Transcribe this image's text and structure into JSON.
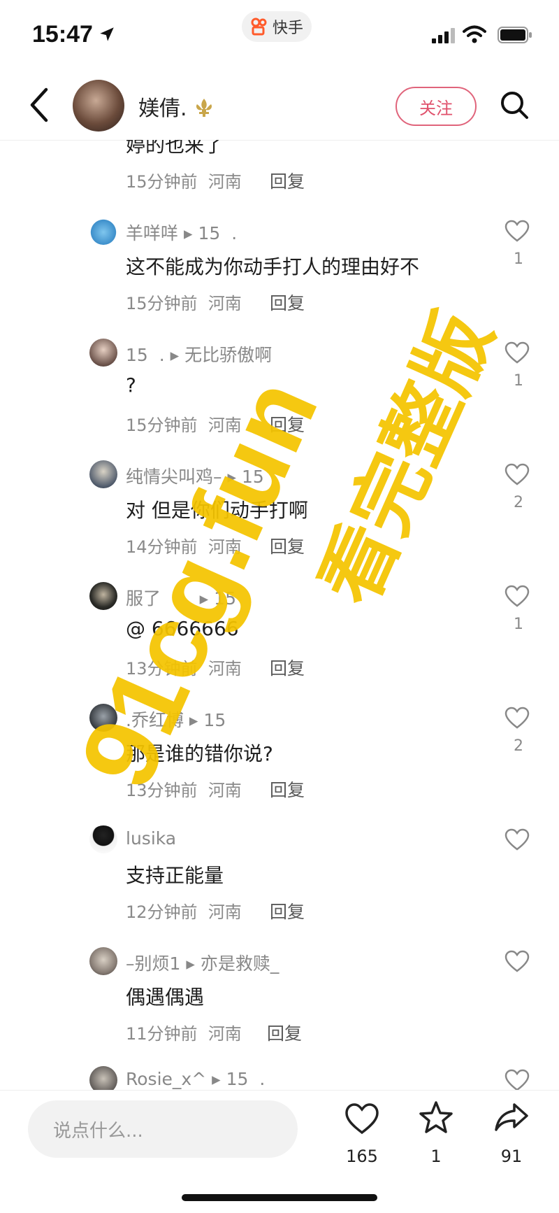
{
  "status_bar": {
    "time": "15:47",
    "app_tag": "快手"
  },
  "header": {
    "username": "媄倩.",
    "follow_label": "关注"
  },
  "partial_top": {
    "text": "婷的也来了",
    "time": "15分钟前",
    "region": "河南",
    "reply": "回复"
  },
  "comments": [
    {
      "name": "羊咩咩",
      "arrow": "▸",
      "target": "15",
      "text": "这不能成为你动手打人的理由好不",
      "time": "15分钟前",
      "region": "河南",
      "reply": "回复",
      "likes": "1"
    },
    {
      "name": "15",
      "arrow": "▸",
      "target": "无比骄傲啊",
      "text": "?",
      "time": "15分钟前",
      "region": "河南",
      "reply": "回复",
      "likes": "1"
    },
    {
      "name": "纯情尖叫鸡–",
      "arrow": "▸",
      "target": "15",
      "text": "对 但是你们动手打啊",
      "time": "14分钟前",
      "region": "河南",
      "reply": "回复",
      "likes": "2"
    },
    {
      "name": "服了",
      "arrow": "▸",
      "target": "15",
      "text": "@ 6666666",
      "time": "13分钟前",
      "region": "河南",
      "reply": "回复",
      "likes": "1"
    },
    {
      "name": ".乔红博",
      "arrow": "▸",
      "target": "15",
      "text": "那是谁的错你说?",
      "time": "13分钟前",
      "region": "河南",
      "reply": "回复",
      "likes": "2"
    },
    {
      "name": "lusika",
      "arrow": "",
      "target": "",
      "text": "支持正能量",
      "time": "12分钟前",
      "region": "河南",
      "reply": "回复",
      "likes": ""
    },
    {
      "name": "–别烦1",
      "arrow": "▸",
      "target": "亦是救赎_",
      "text": "偶遇偶遇",
      "time": "11分钟前",
      "region": "河南",
      "reply": "回复",
      "likes": ""
    },
    {
      "name": "Rosie_x^",
      "arrow": "▸",
      "target": "15",
      "text": "",
      "time": "",
      "region": "",
      "reply": "",
      "likes": ""
    }
  ],
  "bottom_bar": {
    "placeholder": "说点什么...",
    "like_count": "165",
    "collect_count": "1",
    "share_count": "91"
  },
  "watermark": {
    "line1": "91cg.fun",
    "line2": "看完整版"
  },
  "colors": {
    "accent": "#e0506b",
    "watermark": "#f5c400"
  }
}
